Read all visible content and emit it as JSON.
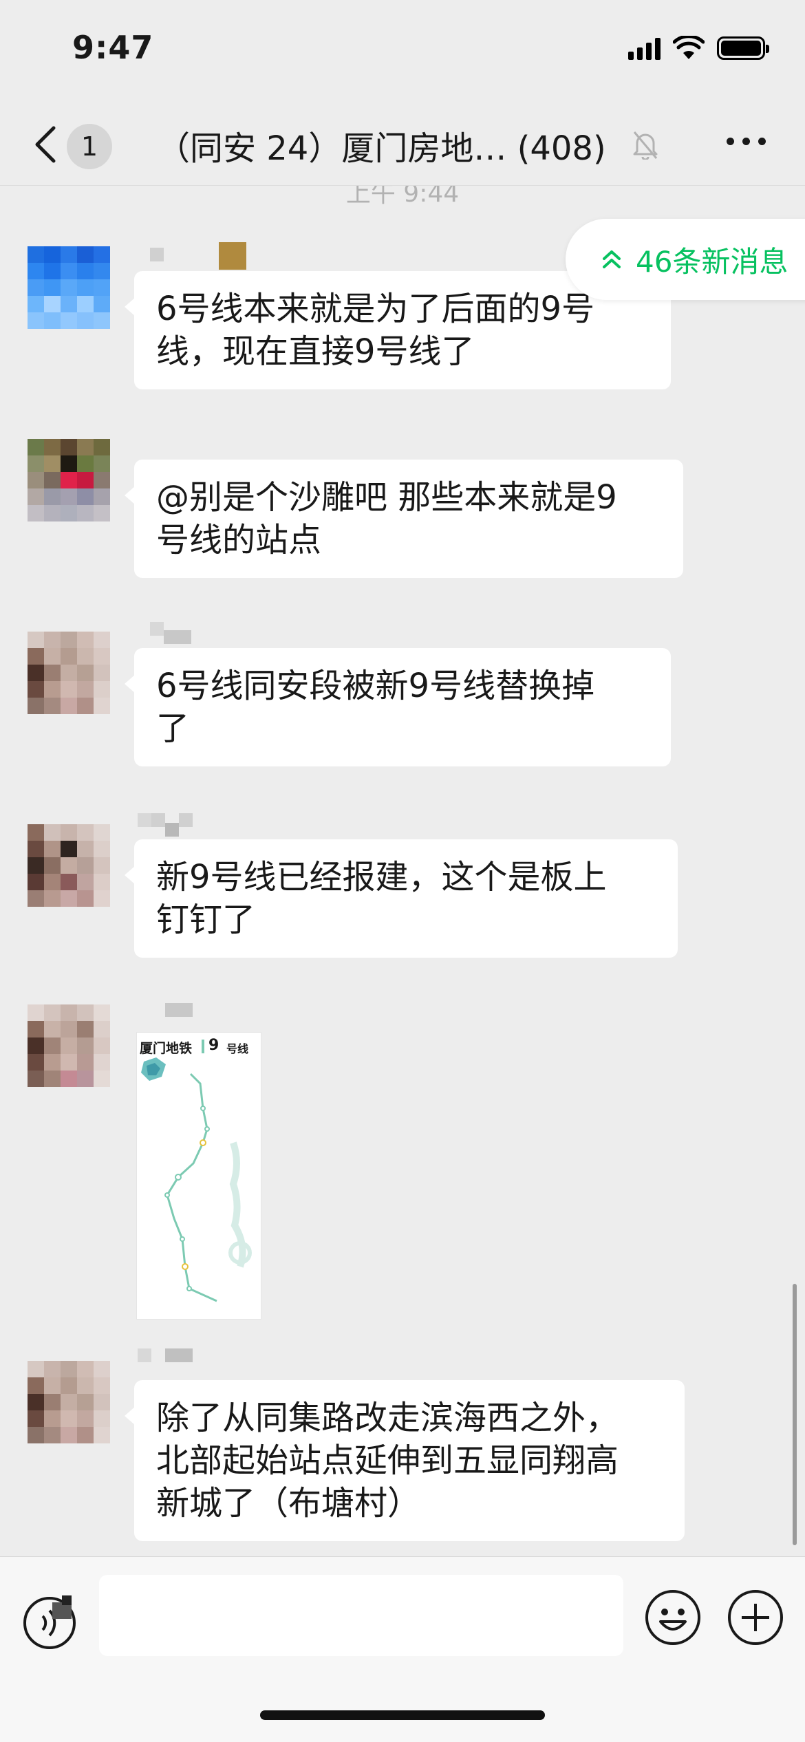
{
  "status_bar": {
    "time": "9:47"
  },
  "nav": {
    "unread_count": "1",
    "title": "（同安 24）厦门房地…  (408)"
  },
  "timestamp": "上午 9:44",
  "new_messages_pill": {
    "text": "46条新消息"
  },
  "messages": [
    {
      "type": "text",
      "lines": [
        "6号线本来就是为了后面的9号",
        "线，现在直接9号线了"
      ]
    },
    {
      "type": "text",
      "lines": [
        "@别是个沙雕吧 那些本来就是9",
        "号线的站点"
      ]
    },
    {
      "type": "text",
      "lines": [
        "6号线同安段被新9号线替换掉",
        "了"
      ]
    },
    {
      "type": "text",
      "lines": [
        "新9号线已经报建，这个是板上",
        "钉钉了"
      ]
    },
    {
      "type": "image",
      "map_title": "厦门地铁",
      "map_line": "9",
      "map_suffix": "号线"
    },
    {
      "type": "text",
      "lines": [
        "除了从同集路改走滨海西之外，",
        "北部起始站点延伸到五显同翔高",
        "新城了（布塘村）"
      ]
    }
  ],
  "input": {
    "value": ""
  },
  "colors": {
    "accent": "#07c160",
    "background": "#ededed",
    "bubble": "#ffffff"
  },
  "icons": [
    "back-chevron-icon",
    "mute-bell-icon",
    "more-dots-icon",
    "double-chevron-up-icon",
    "voice-icon",
    "emoji-icon",
    "plus-icon"
  ]
}
